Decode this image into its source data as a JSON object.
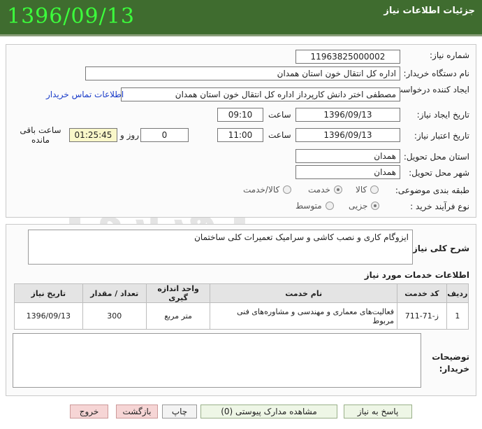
{
  "header": {
    "title": "جزئیات اطلاعات نیاز",
    "date": "1396/09/13"
  },
  "form": {
    "need_number_label": "شماره نیاز:",
    "need_number": "1196382500000‌2",
    "buyer_org_label": "نام دستگاه خریدار:",
    "buyer_org": "اداره کل انتقال خون استان همدان",
    "requester_label": "ایجاد کننده درخواست:",
    "requester": "مصطفی اختر دانش کارپرداز اداره کل انتقال خون استان همدان",
    "contact_link": "اطلاعات تماس خریدار",
    "created_label": "تاریخ ایجاد نیاز:",
    "created_date": "1396/09/13",
    "time_label": "ساعت",
    "created_time": "09:10",
    "validity_label": "تاریخ اعتبار نیاز:",
    "validity_date": "1396/09/13",
    "validity_time": "11:00",
    "days_value": "0",
    "days_label": "روز و",
    "remaining_time": "01:25:45",
    "remaining_label": "ساعت باقی مانده",
    "province_label": "استان محل تحویل:",
    "province": "همدان",
    "city_label": "شهر محل تحویل:",
    "city": "همدان",
    "category_label": "طبقه بندی موضوعی:",
    "category_options": [
      "کالا",
      "خدمت",
      "کالا/خدمت"
    ],
    "category_selected": "خدمت",
    "process_label": "نوع فرآیند خرید :",
    "process_options": [
      "جزیی",
      "متوسط"
    ],
    "process_selected": "جزیی"
  },
  "description": {
    "label": "شرح کلی نیاز:",
    "text": "ایزوگام کاری و نصب کاشی و سرامیک تعمیرات کلی ساختمان"
  },
  "services": {
    "title": "اطلاعات خدمات مورد نیاز",
    "columns": [
      "ردیف",
      "کد خدمت",
      "نام خدمت",
      "واحد اندازه گیری",
      "تعداد / مقدار",
      "تاریخ نیاز"
    ],
    "rows": [
      [
        "1",
        "ز-71-711",
        "فعالیت‌های معماری و مهندسی و مشاوره‌های فنی مربوط",
        "متر مربع",
        "300",
        "1396/09/13"
      ]
    ]
  },
  "notes": {
    "label": "توضیحات خریدار:"
  },
  "buttons": {
    "reply": "پاسخ به نیاز",
    "attachments": "مشاهده مدارک پیوستی (0)",
    "print": "چاپ",
    "back": "بازگشت",
    "exit": "خروج"
  },
  "watermark": {
    "main": "هزاره",
    "sub": "ارتباط گستران"
  },
  "colors": {
    "header_bg": "#3f6c2f",
    "header_date": "#3cff3c",
    "link": "#1a3cc9"
  }
}
